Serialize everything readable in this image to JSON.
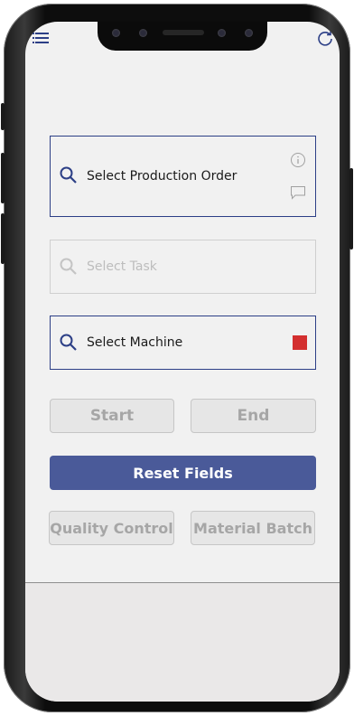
{
  "header": {
    "menu_icon": "hamburger-menu-icon",
    "refresh_icon": "refresh-icon"
  },
  "fields": {
    "production_order": {
      "placeholder": "Select Production Order",
      "icon": "search-icon",
      "info_icon": "info-icon",
      "comment_icon": "comment-icon"
    },
    "task": {
      "placeholder": "Select Task",
      "icon": "search-icon",
      "state": "disabled"
    },
    "machine": {
      "placeholder": "Select Machine",
      "icon": "search-icon",
      "status_color": "#d32f2f"
    }
  },
  "buttons": {
    "start": "Start",
    "end": "End",
    "reset": "Reset Fields",
    "quality_control": "Quality Control",
    "material_batch": "Material Batch"
  },
  "colors": {
    "accent": "#2c3f86",
    "primary_button": "#4a5a99",
    "disabled_text": "#a6a6a6",
    "status_red": "#d32f2f"
  }
}
